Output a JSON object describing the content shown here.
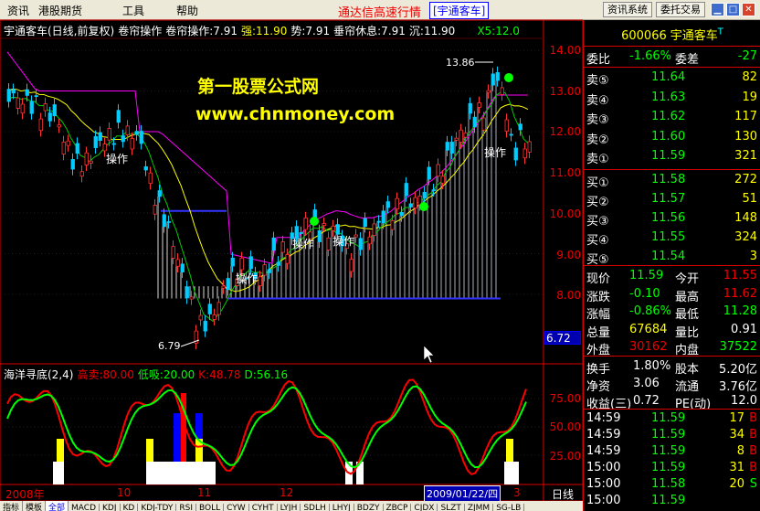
{
  "menu": {
    "items": [
      "资讯",
      "港股期货",
      "工具",
      "帮助"
    ],
    "window_title": "通达信高速行情",
    "stock_tag": "[宇通客车]",
    "right_buttons": [
      "资讯系统",
      "委托交易"
    ],
    "window_controls": [
      "▁",
      "□",
      "✕"
    ]
  },
  "main_chart": {
    "header": {
      "title": "宇通客车(日线,前复权)",
      "indicator": "卷帘操作",
      "indicator_value": "卷帘操作:7.91",
      "strong": "强:11.90",
      "trend": "势:7.91",
      "rest": "垂帘休息:7.91",
      "sink": "沉:11.90",
      "ma_tag": "X5:12.0"
    },
    "watermark_title": "第一股票公式网",
    "watermark_url": "www.chnmoney.com",
    "high_label": "13.86",
    "low_label": "6.79",
    "op_labels": [
      "操作",
      "操作",
      "操作",
      "操作",
      "操作"
    ],
    "y_ticks": [
      "14.00",
      "13.00",
      "12.00",
      "11.00",
      "10.00",
      "9.00",
      "8.00"
    ],
    "cursor_price": "6.72"
  },
  "sub_chart": {
    "name": "海洋寻底(2,4)",
    "sell": "高卖:80.00",
    "buy": "低吸:20.00",
    "k": "K:48.78",
    "d": "D:56.16",
    "y_ticks": [
      "75.00",
      "50.00",
      "25.00"
    ]
  },
  "x_axis": {
    "labels": [
      "2008年",
      "10",
      "11",
      "12",
      "3"
    ],
    "cursor_date": "2009/01/22/四",
    "period": "日线"
  },
  "tabs": [
    "指标",
    "模板",
    "全部",
    "MACD",
    "KDJ",
    "KD",
    "KDJ-TDY",
    "RSI",
    "BOLL",
    "CYW",
    "CYHT",
    "LYJH",
    "SDLH",
    "LHYJ",
    "BDZY",
    "ZBCP",
    "CJDX",
    "SLZT",
    "ZJMM",
    "SG-LB"
  ],
  "quote": {
    "code": "600066",
    "name": "宇通客车",
    "suffix": "T",
    "ratio_label": "委比",
    "ratio": "-1.66%",
    "diff_label": "委差",
    "diff": "-27",
    "asks": [
      {
        "label": "卖⑤",
        "price": "11.64",
        "vol": "82"
      },
      {
        "label": "卖④",
        "price": "11.63",
        "vol": "19"
      },
      {
        "label": "卖③",
        "price": "11.62",
        "vol": "117"
      },
      {
        "label": "卖②",
        "price": "11.60",
        "vol": "130"
      },
      {
        "label": "卖①",
        "price": "11.59",
        "vol": "321"
      }
    ],
    "bids": [
      {
        "label": "买①",
        "price": "11.58",
        "vol": "272"
      },
      {
        "label": "买②",
        "price": "11.57",
        "vol": "51"
      },
      {
        "label": "买③",
        "price": "11.56",
        "vol": "148"
      },
      {
        "label": "买④",
        "price": "11.55",
        "vol": "324"
      },
      {
        "label": "买⑤",
        "price": "11.54",
        "vol": "3"
      }
    ],
    "stats": [
      {
        "l1": "现价",
        "v1": "11.59",
        "l2": "今开",
        "v2": "11.55"
      },
      {
        "l1": "涨跌",
        "v1": "-0.10",
        "l2": "最高",
        "v2": "11.62"
      },
      {
        "l1": "涨幅",
        "v1": "-0.86%",
        "l2": "最低",
        "v2": "11.28"
      },
      {
        "l1": "总量",
        "v1": "67684",
        "l2": "量比",
        "v2": "0.91"
      },
      {
        "l1": "外盘",
        "v1": "30162",
        "l2": "内盘",
        "v2": "37522"
      }
    ],
    "fund": [
      {
        "l1": "换手",
        "v1": "1.80%",
        "l2": "股本",
        "v2": "5.20亿"
      },
      {
        "l1": "净资",
        "v1": "3.06",
        "l2": "流通",
        "v2": "3.76亿"
      },
      {
        "l1": "收益(三)",
        "v1": "0.72",
        "l2": "PE(动)",
        "v2": "12.0"
      }
    ],
    "ticks": [
      {
        "time": "14:59",
        "price": "11.59",
        "vol": "17",
        "side": "B"
      },
      {
        "time": "14:59",
        "price": "11.59",
        "vol": "34",
        "side": "B"
      },
      {
        "time": "14:59",
        "price": "11.59",
        "vol": "8",
        "side": "B"
      },
      {
        "time": "15:00",
        "price": "11.59",
        "vol": "31",
        "side": "B"
      },
      {
        "time": "15:00",
        "price": "11.58",
        "vol": "20",
        "side": "S"
      },
      {
        "time": "15:00",
        "price": "11.59",
        "vol": "",
        "side": ""
      }
    ]
  }
}
